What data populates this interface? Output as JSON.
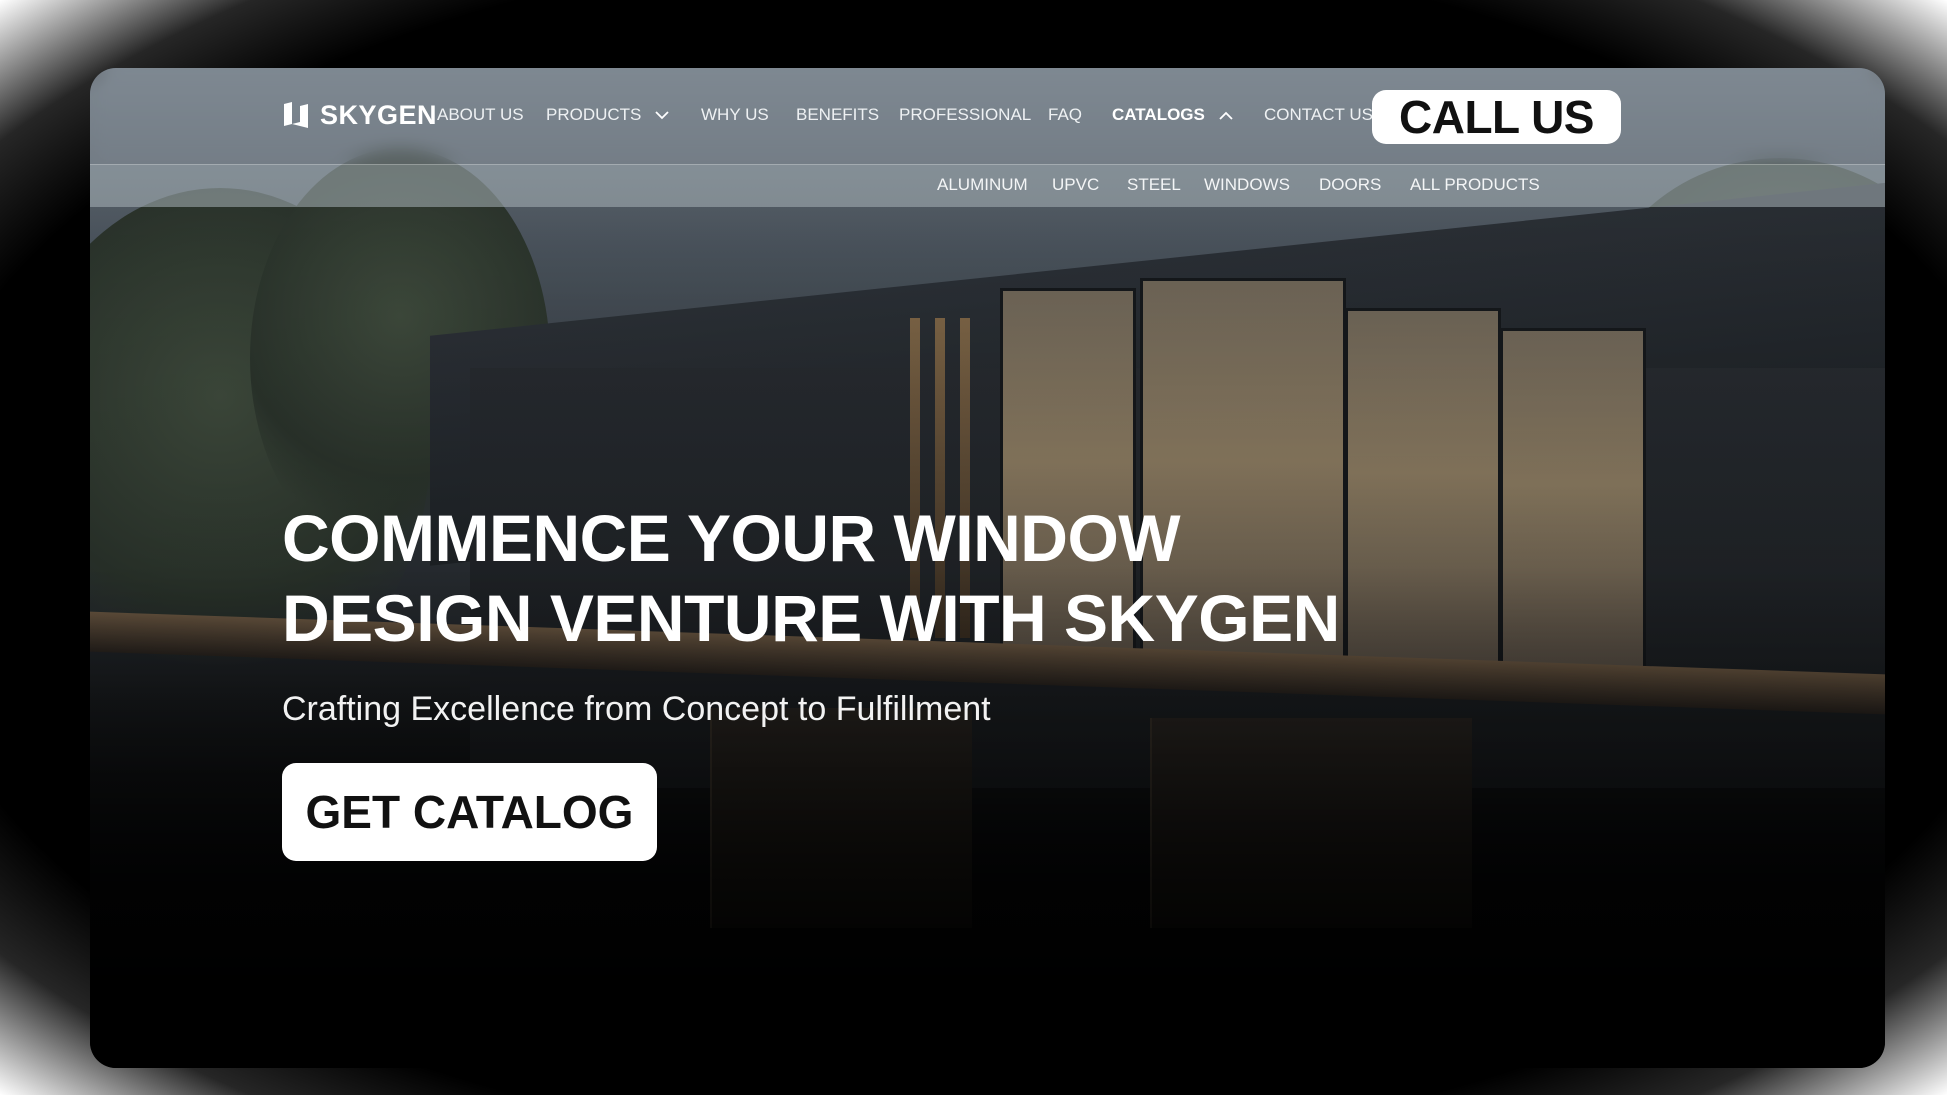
{
  "brand": {
    "name": "SKYGEN"
  },
  "nav": {
    "items": [
      {
        "label": "ABOUT US"
      },
      {
        "label": "PRODUCTS"
      },
      {
        "label": "WHY US"
      },
      {
        "label": "BENEFITS"
      },
      {
        "label": "PROFESSIONAL"
      },
      {
        "label": "FAQ"
      },
      {
        "label": "CATALOGS"
      },
      {
        "label": "CONTACT US"
      }
    ],
    "call_button": "CALL US"
  },
  "submenu": {
    "items": [
      {
        "label": "ALUMINUM"
      },
      {
        "label": "UPVC"
      },
      {
        "label": "STEEL"
      },
      {
        "label": "WINDOWS"
      },
      {
        "label": "DOORS"
      },
      {
        "label": "ALL PRODUCTS"
      }
    ]
  },
  "hero": {
    "title_line1": "COMMENCE YOUR WINDOW",
    "title_line2": "DESIGN VENTURE WITH SKYGEN",
    "subtitle": "Crafting Excellence from Concept to Fulfillment",
    "cta": "GET CATALOG"
  },
  "icons": {
    "logo": "skygen-logo-icon",
    "products_chevron": "chevron-down-icon",
    "catalogs_chevron": "chevron-up-icon"
  },
  "colors": {
    "text": "#ffffff",
    "button_bg": "#ffffff",
    "button_text": "#111111"
  }
}
